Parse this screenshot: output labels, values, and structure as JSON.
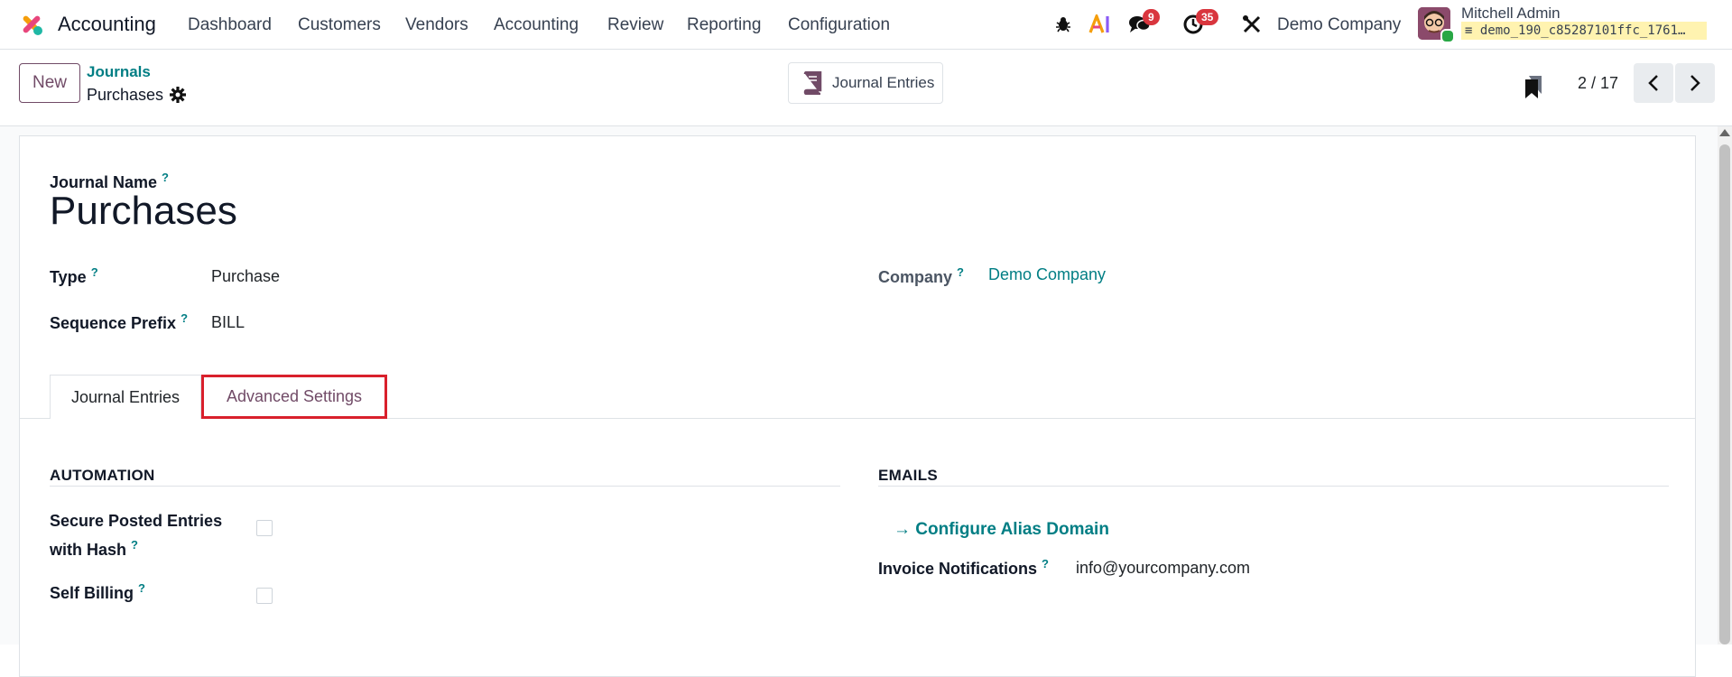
{
  "navbar": {
    "app_name": "Accounting",
    "menu": [
      "Dashboard",
      "Customers",
      "Vendors",
      "Accounting",
      "Review",
      "Reporting",
      "Configuration"
    ],
    "messages_count": "9",
    "activities_count": "35",
    "company": "Demo Company",
    "user_name": "Mitchell Admin",
    "db_name": "demo_190_c85287101ffc_1761…"
  },
  "control_panel": {
    "new_button": "New",
    "breadcrumb_parent": "Journals",
    "breadcrumb_current": "Purchases",
    "smart_button": "Journal Entries",
    "pager": "2 / 17"
  },
  "form": {
    "journal_name_label": "Journal Name",
    "journal_name_value": "Purchases",
    "type_label": "Type",
    "type_value": "Purchase",
    "sequence_prefix_label": "Sequence Prefix",
    "sequence_prefix_value": "BILL",
    "company_label": "Company",
    "company_value": "Demo Company",
    "help_mark": "?",
    "tabs": [
      "Journal Entries",
      "Advanced Settings"
    ],
    "automation": {
      "title": "AUTOMATION",
      "secure_posted_label_line1": "Secure Posted Entries",
      "secure_posted_label_line2": "with Hash",
      "self_billing_label": "Self Billing"
    },
    "emails": {
      "title": "EMAILS",
      "configure_alias": "Configure Alias Domain",
      "invoice_notifications_label": "Invoice Notifications",
      "invoice_notifications_value": "info@yourcompany.com"
    }
  },
  "colors": {
    "brand": "#714b67",
    "link": "#017e84",
    "highlight": "#d9202c",
    "badge": "#d9363e"
  },
  "icons": [
    "odoo-logo-icon",
    "bug-icon",
    "ai-icon",
    "chat-icon",
    "clock-icon",
    "tools-icon",
    "gear-icon",
    "book-icon",
    "bookmark-icon",
    "chevron-left-icon",
    "chevron-right-icon",
    "arrow-right-icon",
    "database-icon"
  ]
}
